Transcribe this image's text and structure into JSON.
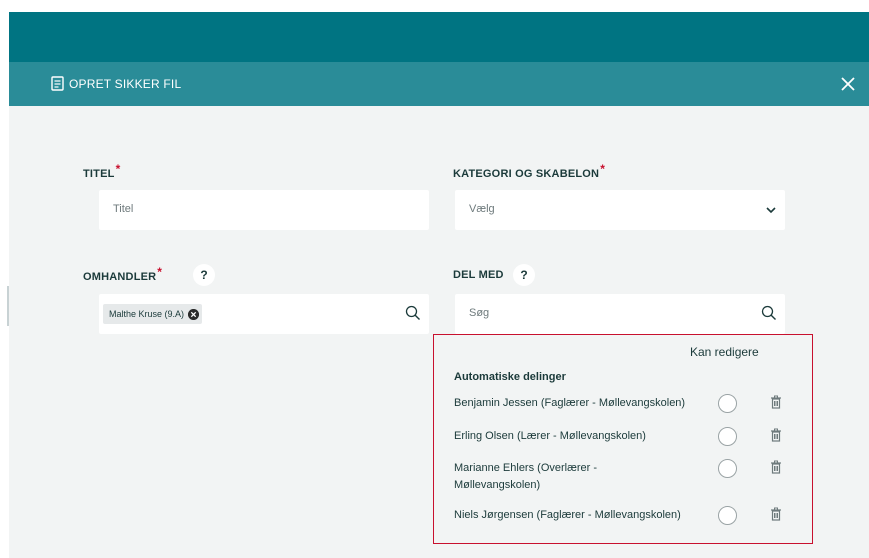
{
  "header": {
    "title": "OPRET SIKKER FIL",
    "icon": "document-icon"
  },
  "fields": {
    "titel": {
      "label": "TITEL",
      "placeholder": "Titel",
      "required_mark": "*"
    },
    "kategori": {
      "label": "KATEGORI OG SKABELON",
      "placeholder": "Vælg",
      "required_mark": "*"
    },
    "omhandler": {
      "label": "OMHANDLER",
      "required_mark": "*",
      "help": "?",
      "chip": "Malthe Kruse (9.A)"
    },
    "del_med": {
      "label": "DEL MED",
      "help": "?",
      "placeholder": "Søg"
    }
  },
  "sharing": {
    "can_edit_header": "Kan redigere",
    "section_title": "Automatiske delinger",
    "people": [
      {
        "name": "Benjamin Jessen (Faglærer - Møllevangskolen)"
      },
      {
        "name": "Erling Olsen (Lærer - Møllevangskolen)"
      },
      {
        "name": "Marianne Ehlers (Overlærer - Møllevangskolen)"
      },
      {
        "name": "Niels Jørgensen (Faglærer - Møllevangskolen)"
      }
    ]
  },
  "colors": {
    "top_bar": "#007482",
    "modal_header": "#2a8c98",
    "required": "#c8102e",
    "highlight_border": "#c8102e"
  }
}
